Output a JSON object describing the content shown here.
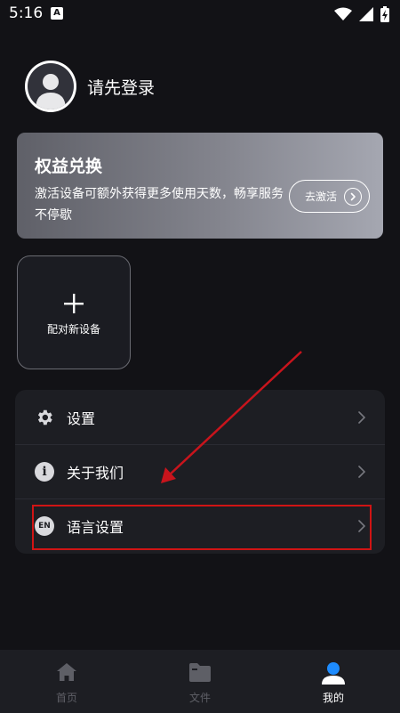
{
  "status_bar": {
    "time": "5:16",
    "notification_icon": "a-notification-icon",
    "icons": [
      "wifi-icon",
      "signal-icon",
      "battery-charging-icon"
    ]
  },
  "profile": {
    "name": "请先登录",
    "avatar_icon": "default-avatar-icon"
  },
  "benefit_card": {
    "title": "权益兑换",
    "description": "激活设备可额外获得更多使用天数，畅享服务不停歇",
    "button_label": "去激活"
  },
  "pair_device": {
    "label": "配对新设备",
    "icon": "plus-icon"
  },
  "menu": {
    "items": [
      {
        "label": "设置",
        "icon": "gear-icon"
      },
      {
        "label": "关于我们",
        "icon": "info-icon"
      },
      {
        "label": "语言设置",
        "icon": "language-en-icon",
        "badge_text": "EN"
      }
    ]
  },
  "annotations": {
    "arrow_color": "#c8141c",
    "highlight_color": "#d01414"
  },
  "bottom_nav": {
    "items": [
      {
        "label": "首页",
        "icon": "home-icon",
        "active": false
      },
      {
        "label": "文件",
        "icon": "folder-icon",
        "active": false
      },
      {
        "label": "我的",
        "icon": "user-icon",
        "active": true
      }
    ],
    "active_color": "#1e8cff"
  },
  "colors": {
    "background": "#121216",
    "card": "#1d1e23"
  }
}
